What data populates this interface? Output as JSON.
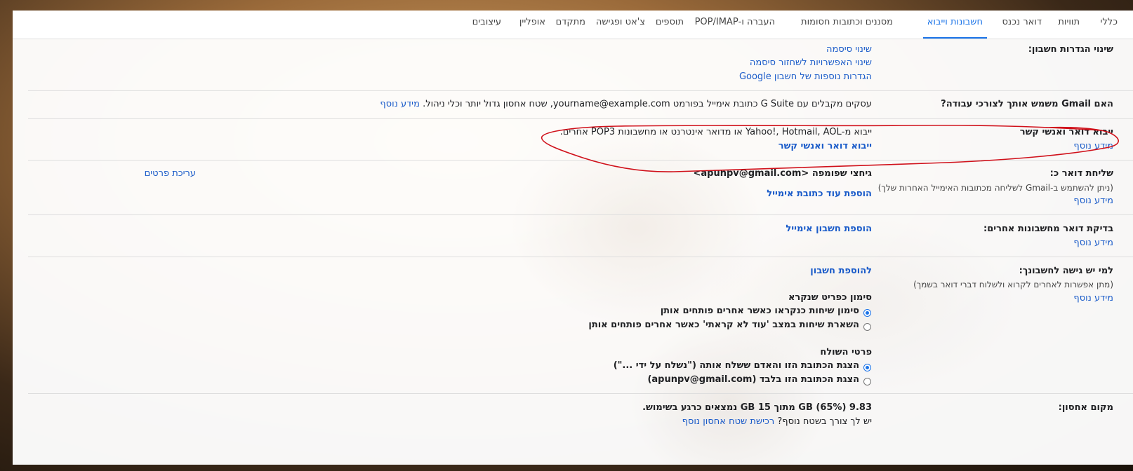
{
  "tabs": [
    {
      "label": "כללי",
      "active": false
    },
    {
      "label": "תוויות",
      "active": false
    },
    {
      "label": "דואר נכנס",
      "active": false
    },
    {
      "label": "חשבונות וייבוא",
      "active": true
    },
    {
      "label": "מסננים וכתובות חסומות",
      "active": false
    },
    {
      "label": "העברה ו-POP/IMAP",
      "active": false
    },
    {
      "label": "תוספים",
      "active": false
    },
    {
      "label": "צ'אט ופגישה",
      "active": false
    },
    {
      "label": "מתקדם",
      "active": false
    },
    {
      "label": "אופליין",
      "active": false
    },
    {
      "label": "עיצובים",
      "active": false
    }
  ],
  "change_account": {
    "label": "שינוי הגדרות חשבון:",
    "links": [
      "שינוי סיסמה",
      "שינוי האפשרויות לשחזור סיסמה",
      "הגדרות נוספות של חשבון Google"
    ]
  },
  "work": {
    "label": "האם Gmail משמש אותך לצורכי עבודה?",
    "text": "עסקים מקבלים עם G Suite כתובת אימייל בפורמט yourname@example.com, שטח אחסון גדול יותר וכלי ניהול.",
    "learn_more": "מידע נוסף"
  },
  "import": {
    "label": "ייבוא דואר ואנשי קשר",
    "learn_more": "מידע נוסף",
    "text": "ייבוא מ-Yahoo!, Hotmail, AOL או מדואר אינטרנט או מחשבונות POP3 אחרים.",
    "action": "ייבוא דואר ואנשי קשר"
  },
  "send_as": {
    "label": "שליחת דואר כ:",
    "sub": "(ניתן להשתמש ב-Gmail לשליחה מכתובות האימייל האחרות שלך)",
    "learn_more": "מידע נוסף",
    "identity": "גיחצי שפומפה <apunpv@gmail.com>",
    "edit": "עריכת פרטים",
    "add": "הוספת עוד כתובת אימייל"
  },
  "check_mail": {
    "label": "בדיקת דואר מחשבונות אחרים:",
    "learn_more": "מידע נוסף",
    "add": "הוספת חשבון אימייל"
  },
  "grant": {
    "label": "למי יש גישה לחשבונך:",
    "sub": "(מתן אפשרות לאחרים לקרוא ולשלוח דברי דואר בשמך)",
    "learn_more": "מידע נוסף",
    "add": "להוספת חשבון",
    "read_heading": "סימון כפריט שנקרא",
    "read_opt1": "סימון שיחות כנקראו כאשר אחרים פותחים אותן",
    "read_opt2": "השארת שיחות במצב 'עוד לא קראתי' כאשר אחרים פותחים אותן",
    "sender_heading": "פרטי השולח",
    "sender_opt1": "הצגת הכתובת הזו והאדם ששלח אותה (\"נשלח על ידי ...\")",
    "sender_opt2": "הצגת הכתובת הזו בלבד (apunpv@gmail.com)"
  },
  "storage": {
    "label": "מקום אחסון:",
    "usage": "9.83 GB (65%) מתוך 15 GB נמצאים כרגע בשימוש.",
    "question": "יש לך צורך בשטח נוסף?",
    "buy": "רכישת שטח אחסון נוסף"
  },
  "colors": {
    "accent": "#1a73e8",
    "link": "#1a5bc9",
    "annotation": "#d0101a"
  }
}
